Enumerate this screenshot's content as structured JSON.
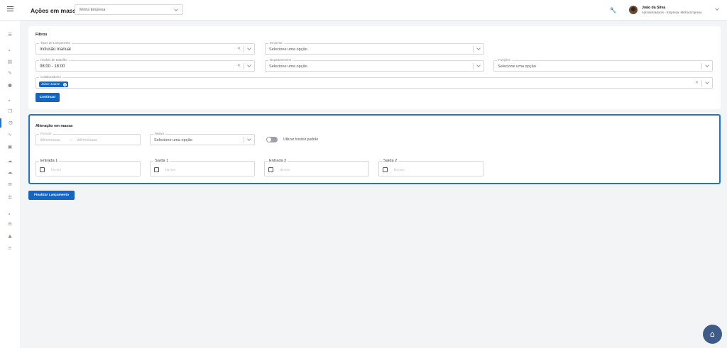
{
  "header": {
    "title": "Ações em massa",
    "company_select": "Minha Empresa",
    "user_name": "João da Silva",
    "user_role": "Administradores - Empresa: Minha Empresa",
    "tool_icon": "wrench-icon"
  },
  "sidebar": {
    "icons": [
      "bar-chart-icon",
      "document-icon",
      "pen-icon",
      "person-icon",
      "copy-icon",
      "clock-icon",
      "trend-icon",
      "chat-icon",
      "cloud-icon",
      "cloud-icon",
      "mail-icon",
      "key-icon",
      "gear-icon",
      "user-icon",
      "list-icon"
    ],
    "active": "clock-icon"
  },
  "filters": {
    "title": "Filtros",
    "tipo_label": "Tipos de Lançamento",
    "tipo_value": "Inclusão manual",
    "empresa_label": "Empresa",
    "empresa_placeholder": "Selecione uma opção",
    "horario_label": "Horário de trabalho",
    "horario_value": "08:00 - 18:00",
    "departamentos_label": "Departamentos",
    "departamentos_placeholder": "Selecione uma opção",
    "funcoes_label": "Funções",
    "funcoes_placeholder": "Selecione uma opção",
    "colaboradores_label": "Colaboradores",
    "colaborador_chip": "Jaime Juarez",
    "continue_button": "Continuar"
  },
  "mass_change": {
    "title": "Alteração em massa",
    "periodo_label": "Período",
    "periodo_start_placeholder": "dd/mm/aaaa",
    "periodo_end_placeholder": "dd/mm/aaaa",
    "motivo_label": "Motivo",
    "motivo_placeholder": "Selecione uma opção",
    "toggle_label": "Utilizar horário padrão",
    "toggle_on": false,
    "times": [
      {
        "label": "Entrada 1",
        "placeholder": "hh:mm"
      },
      {
        "label": "Saída 1",
        "placeholder": "hh:mm"
      },
      {
        "label": "Entrada 2",
        "placeholder": "hh:mm"
      },
      {
        "label": "Saída 2",
        "placeholder": "hh:mm"
      }
    ]
  },
  "finalize_button": "Finalizar Lançamento",
  "accent_color": "#1565c0"
}
